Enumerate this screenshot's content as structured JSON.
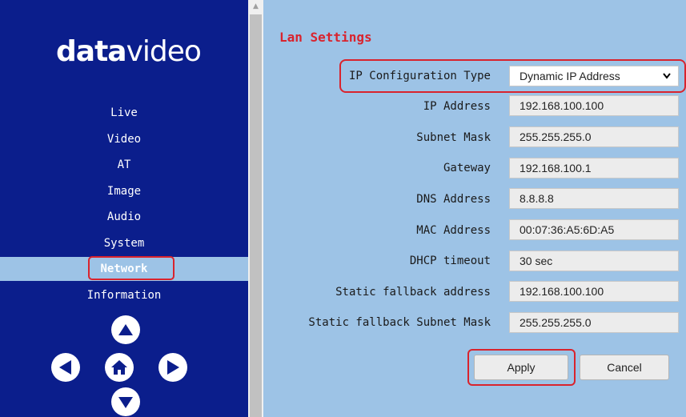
{
  "brand": {
    "logo_bold": "data",
    "logo_light": "video"
  },
  "sidebar": {
    "items": [
      {
        "label": "Live"
      },
      {
        "label": "Video"
      },
      {
        "label": "AT"
      },
      {
        "label": "Image"
      },
      {
        "label": "Audio"
      },
      {
        "label": "System"
      },
      {
        "label": "Network",
        "active": true
      },
      {
        "label": "Information"
      }
    ],
    "nav_buttons": [
      "arrow-up-icon",
      "arrow-left-icon",
      "home-icon",
      "arrow-right-icon",
      "arrow-down-icon"
    ]
  },
  "main": {
    "section_title": "Lan Settings",
    "ip_config": {
      "label": "IP Configuration Type",
      "value": "Dynamic IP Address"
    },
    "fields": [
      {
        "label": "IP Address",
        "value": "192.168.100.100"
      },
      {
        "label": "Subnet Mask",
        "value": "255.255.255.0"
      },
      {
        "label": "Gateway",
        "value": "192.168.100.1"
      },
      {
        "label": "DNS Address",
        "value": "8.8.8.8"
      },
      {
        "label": "MAC Address",
        "value": "00:07:36:A5:6D:A5"
      },
      {
        "label": "DHCP timeout",
        "value": "30 sec"
      },
      {
        "label": "Static fallback address",
        "value": "192.168.100.100"
      },
      {
        "label": "Static fallback Subnet Mask",
        "value": "255.255.255.0"
      }
    ],
    "buttons": {
      "apply": "Apply",
      "cancel": "Cancel"
    }
  },
  "colors": {
    "sidebar_bg": "#0b1e8c",
    "content_bg": "#9dc3e6",
    "highlight": "#d9232d"
  }
}
